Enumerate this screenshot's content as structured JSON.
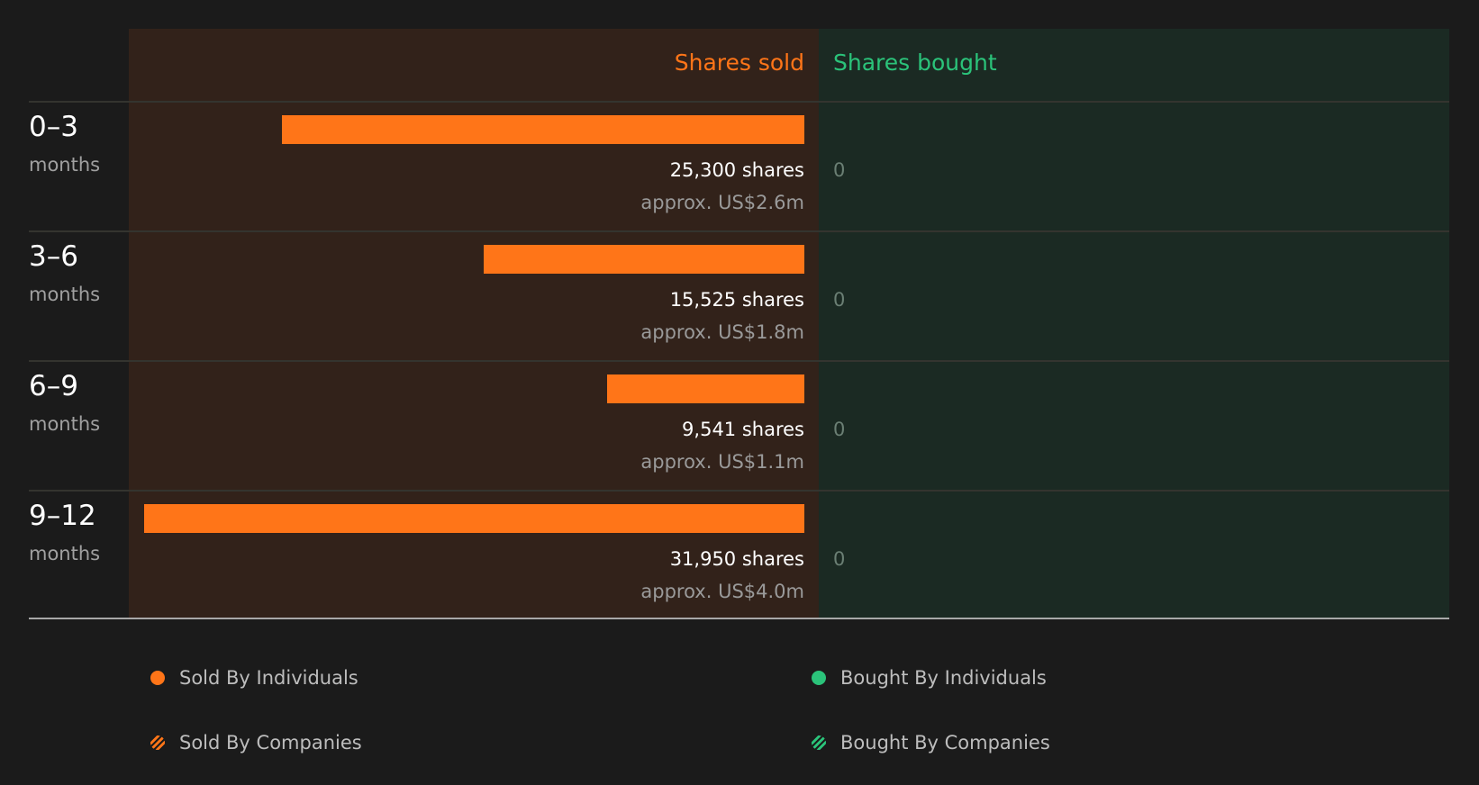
{
  "chart_data": {
    "type": "bar",
    "orientation": "horizontal-diverging",
    "columns": {
      "sold": "Shares sold",
      "bought": "Shares bought"
    },
    "unit_label": "months",
    "categories": [
      "0–3",
      "3–6",
      "6–9",
      "9–12"
    ],
    "series": [
      {
        "name": "Shares sold",
        "values": [
          25300,
          15525,
          9541,
          31950
        ],
        "labels": [
          "25,300 shares",
          "15,525 shares",
          "9,541 shares",
          "31,950 shares"
        ],
        "approx": [
          "approx. US$2.6m",
          "approx. US$1.8m",
          "approx. US$1.1m",
          "approx. US$4.0m"
        ]
      },
      {
        "name": "Shares bought",
        "values": [
          0,
          0,
          0,
          0
        ],
        "labels": [
          "0",
          "0",
          "0",
          "0"
        ]
      }
    ],
    "xlim": [
      0,
      31950
    ],
    "legend": [
      {
        "label": "Sold By Individuals",
        "style": "solid",
        "color": "#ff7518"
      },
      {
        "label": "Bought By Individuals",
        "style": "solid",
        "color": "#2bc37a"
      },
      {
        "label": "Sold By Companies",
        "style": "hatched",
        "color": "#ff7518"
      },
      {
        "label": "Bought By Companies",
        "style": "hatched",
        "color": "#2bc37a"
      }
    ],
    "legend_position": "bottom",
    "colors": {
      "sold": "#ff7518",
      "bought": "#2bc37a",
      "sold_panel": "#32221a",
      "bought_panel": "#1b2a23",
      "background": "#1b1b1b"
    }
  }
}
